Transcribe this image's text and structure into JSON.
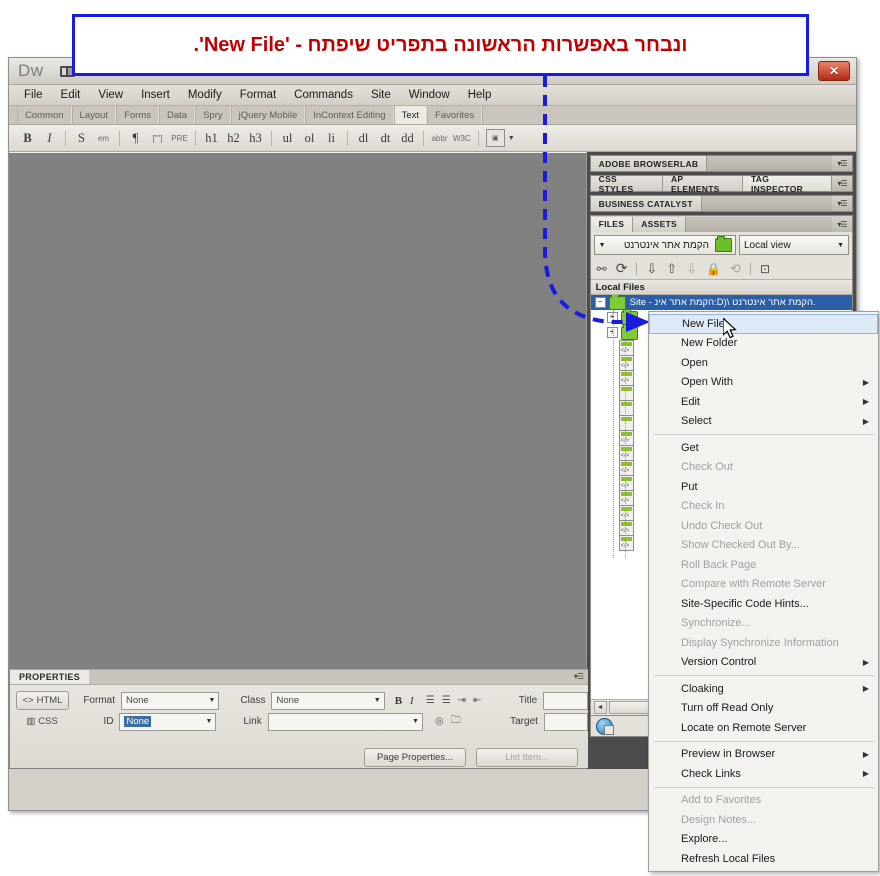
{
  "callout": {
    "text": "ונבחר באפשרות הראשונה בתפריט שיפתח - 'New File'.",
    "border_color": "#1a1ae0",
    "text_color": "#c00000"
  },
  "window": {
    "app_logo": "Dw",
    "close_label": "✕"
  },
  "menubar": {
    "items": [
      "File",
      "Edit",
      "View",
      "Insert",
      "Modify",
      "Format",
      "Commands",
      "Site",
      "Window",
      "Help"
    ]
  },
  "insertbar": {
    "tabs": [
      "Common",
      "Layout",
      "Forms",
      "Data",
      "Spry",
      "jQuery Mobile",
      "InContext Editing",
      "Text",
      "Favorites"
    ],
    "active": "Text"
  },
  "formatbar": {
    "buttons": [
      "B",
      "I",
      "S",
      "em",
      "¶",
      "[\"\"]",
      "PRE",
      "h1",
      "h2",
      "h3",
      "ul",
      "ol",
      "li",
      "dl",
      "dt",
      "dd",
      "abbr",
      "W3C"
    ]
  },
  "properties": {
    "title": "PROPERTIES",
    "html_label": "HTML",
    "css_label": "CSS",
    "format_label": "Format",
    "format_value": "None",
    "id_label": "ID",
    "id_value": "None",
    "class_label": "Class",
    "class_value": "None",
    "link_label": "Link",
    "link_value": "",
    "title_label": "Title",
    "title_value": "",
    "target_label": "Target",
    "target_value": "",
    "bold": "B",
    "italic": "I",
    "page_properties_button": "Page Properties...",
    "list_item_button": "List Item..."
  },
  "dock": {
    "browserlab": "ADOBE BROWSERLAB",
    "css_styles": "CSS STYLES",
    "ap_elements": "AP ELEMENTS",
    "tag_inspector": "TAG INSPECTOR",
    "business_catalyst": "BUSINESS CATALYST",
    "files_tab": "FILES",
    "assets_tab": "ASSETS",
    "site_name": "הקמת אתר אינטרנט",
    "view_mode": "Local view",
    "local_files_header": "Local Files",
    "site_root_label": "Site - הקמת אתר אינ:D)\\ הקמת אתר אינטרנט.",
    "toolbar_icons": [
      "connect-icon",
      "refresh-icon",
      "get-files-icon",
      "put-files-icon",
      "check-out-icon",
      "check-in-icon",
      "synchronize-icon",
      "expand-icon"
    ]
  },
  "tree": {
    "folders": 2,
    "files": 14
  },
  "context_menu": {
    "items": [
      {
        "label": "New File",
        "state": "highlighted",
        "submenu": false
      },
      {
        "label": "New Folder",
        "state": "normal",
        "submenu": false
      },
      {
        "label": "Open",
        "state": "normal",
        "submenu": false
      },
      {
        "label": "Open With",
        "state": "normal",
        "submenu": true
      },
      {
        "label": "Edit",
        "state": "normal",
        "submenu": true
      },
      {
        "label": "Select",
        "state": "normal",
        "submenu": true
      },
      {
        "separator": true
      },
      {
        "label": "Get",
        "state": "normal",
        "submenu": false
      },
      {
        "label": "Check Out",
        "state": "disabled",
        "submenu": false
      },
      {
        "label": "Put",
        "state": "normal",
        "submenu": false
      },
      {
        "label": "Check In",
        "state": "disabled",
        "submenu": false
      },
      {
        "label": "Undo Check Out",
        "state": "disabled",
        "submenu": false
      },
      {
        "label": "Show Checked Out By...",
        "state": "disabled",
        "submenu": false
      },
      {
        "label": "Roll Back Page",
        "state": "disabled",
        "submenu": false
      },
      {
        "label": "Compare with Remote Server",
        "state": "disabled",
        "submenu": false
      },
      {
        "label": "Site-Specific Code Hints...",
        "state": "normal",
        "submenu": false
      },
      {
        "label": "Synchronize...",
        "state": "disabled",
        "submenu": false
      },
      {
        "label": "Display Synchronize Information",
        "state": "disabled",
        "submenu": false
      },
      {
        "label": "Version Control",
        "state": "normal",
        "submenu": true
      },
      {
        "separator": true
      },
      {
        "label": "Cloaking",
        "state": "normal",
        "submenu": true
      },
      {
        "label": "Turn off Read Only",
        "state": "normal",
        "submenu": false
      },
      {
        "label": "Locate on Remote Server",
        "state": "normal",
        "submenu": false
      },
      {
        "separator": true
      },
      {
        "label": "Preview in Browser",
        "state": "normal",
        "submenu": true
      },
      {
        "label": "Check Links",
        "state": "normal",
        "submenu": true
      },
      {
        "separator": true
      },
      {
        "label": "Add to Favorites",
        "state": "disabled",
        "submenu": false
      },
      {
        "label": "Design Notes...",
        "state": "disabled",
        "submenu": false
      },
      {
        "label": "Explore...",
        "state": "normal",
        "submenu": false
      },
      {
        "label": "Refresh Local Files",
        "state": "normal",
        "submenu": false
      }
    ]
  }
}
